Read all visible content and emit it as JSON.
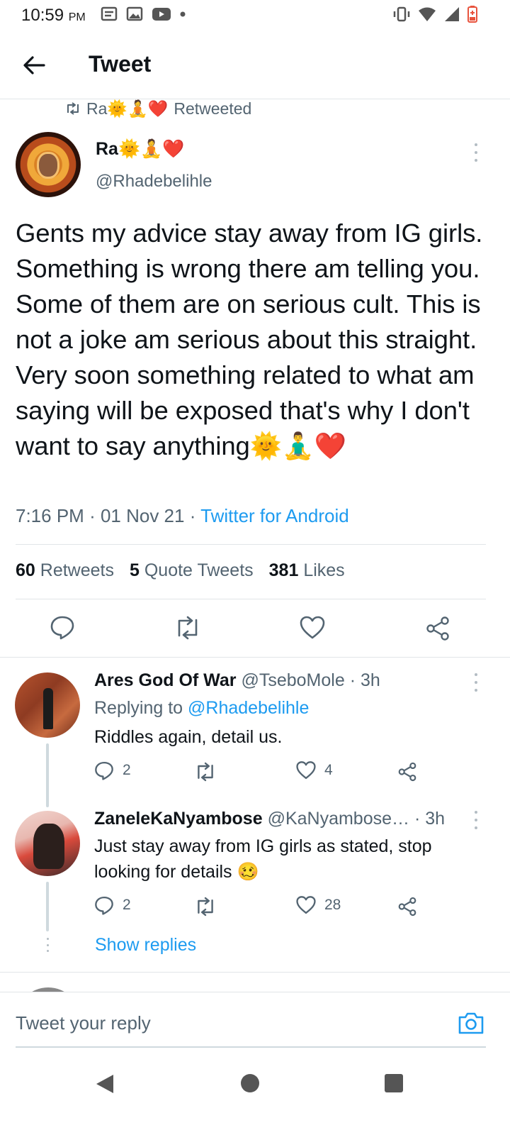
{
  "status": {
    "time": "10:59",
    "ampm": "PM"
  },
  "header": {
    "title": "Tweet"
  },
  "retweet_banner": {
    "name": "Ra🌞🧘❤️",
    "label": "Retweeted"
  },
  "tweet": {
    "author_name": "Ra🌞🧘❤️",
    "author_handle": "@Rhadebelihle",
    "text": "Gents my advice stay away from IG girls. Something is wrong there am telling you. Some of them are on serious cult. This is not a joke am serious about this straight. Very soon something related to what am saying will be exposed that's why I don't want to say anything🌞🧘‍♂️❤️",
    "time": "7:16 PM",
    "date": "01 Nov 21",
    "source": "Twitter for Android",
    "retweets_count": "60",
    "retweets_label": "Retweets",
    "quotes_count": "5",
    "quotes_label": "Quote Tweets",
    "likes_count": "381",
    "likes_label": "Likes"
  },
  "replies": [
    {
      "name": "Ares God Of War",
      "handle": "@TseboMole",
      "time": "3h",
      "replying_prefix": "Replying to",
      "replying_to": "@Rhadebelihle",
      "text": "Riddles again, detail us.",
      "reply_count": "2",
      "like_count": "4"
    },
    {
      "name": "ZaneleKaNyambose",
      "handle": "@KaNyambose…",
      "time": "3h",
      "text": "Just stay away from IG girls as stated, stop looking for details 🥴",
      "reply_count": "2",
      "like_count": "28"
    }
  ],
  "show_replies": "Show replies",
  "composer": {
    "placeholder": "Tweet your reply"
  },
  "colors": {
    "accent": "#1d9bf0",
    "secondary_text": "#536471",
    "primary_text": "#0f1419",
    "divider": "#e1e5e8"
  },
  "icons": {
    "back": "arrow-left-icon",
    "retweet": "retweet-icon",
    "reply": "comment-bubble-icon",
    "like": "heart-icon",
    "share": "share-nodes-icon",
    "camera": "camera-icon",
    "more": "vertical-dots-icon"
  }
}
